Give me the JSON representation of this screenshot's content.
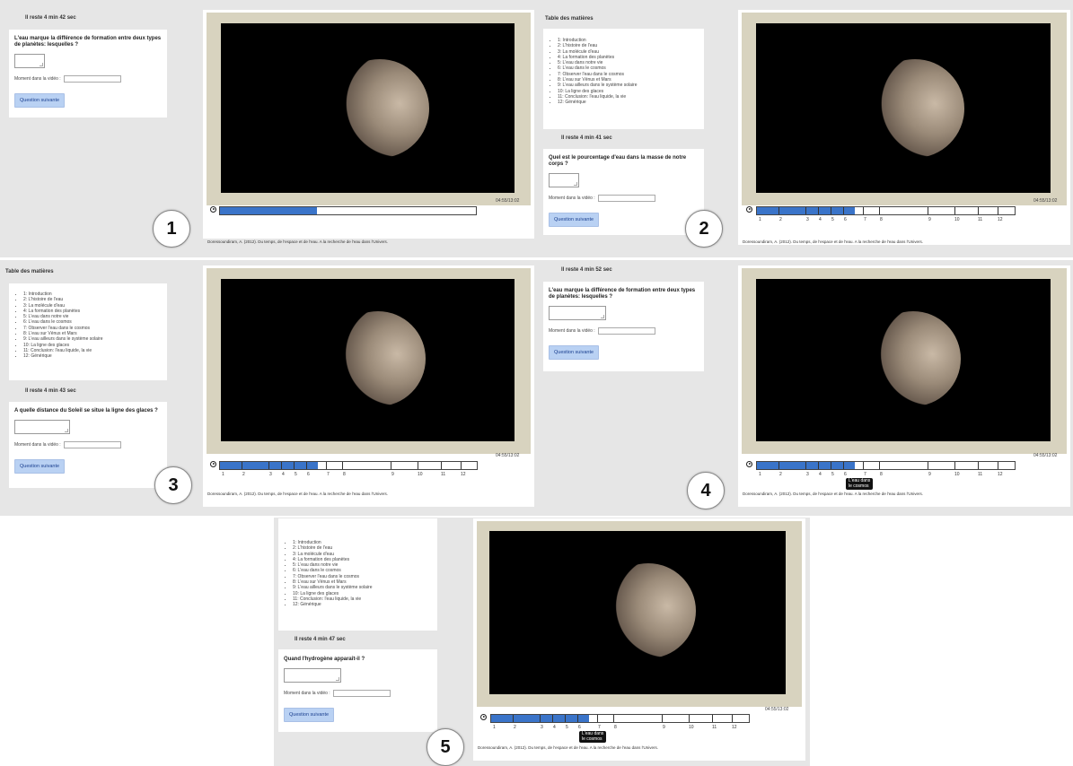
{
  "toc": {
    "title": "Table des matières",
    "items": [
      "1: Introduction",
      "2: L'histoire de l'eau",
      "3: La molécule d'eau",
      "4: La formation des planètes",
      "5: L'eau dans notre vie",
      "6: L'eau dans le cosmos",
      "7: Observer l'eau dans le cosmos",
      "8: L'eau sur Vénus et Mars",
      "9: L'eau ailleurs dans le système solaire",
      "10: La ligne des glaces",
      "11: Conclusion: l'eau liquide, la vie",
      "12: Générique"
    ]
  },
  "common": {
    "moment_label": "Moment dans la vidéo :",
    "next_button": "Question suivante",
    "timecode": "04:55/13:02",
    "citation": "Doressoundiram, A. (2012). Du temps, de l'espace et de l'eau. A la recherche de l'eau dans l'Univers.",
    "chapter_numbers": [
      "1",
      "2",
      "3",
      "4",
      "5",
      "6",
      "7",
      "8",
      "9",
      "10",
      "11",
      "12"
    ],
    "tooltip": "L'eau dans\nle cosmos",
    "accent_color": "#3a74c9",
    "button_color": "#b9d1f3"
  },
  "panels": [
    {
      "badge": "1",
      "timer": "Il reste 4 min 42 sec",
      "question": "L'eau marque la différence de formation entre deux types de planètes: lesquelles ?",
      "progress": 0.38
    },
    {
      "badge": "2",
      "timer": "Il reste 4 min 41 sec",
      "question": "Quel est le pourcentage d'eau dans la masse de notre corps ?",
      "progress": 0.38
    },
    {
      "badge": "3",
      "timer": "Il reste 4 min 43 sec",
      "question": "A quelle distance du Soleil se situe la ligne des glaces ?",
      "progress": 0.38
    },
    {
      "badge": "4",
      "timer": "Il reste 4 min 52 sec",
      "question": "L'eau marque la différence de formation entre deux types de planètes: lesquelles ?",
      "progress": 0.38
    },
    {
      "badge": "5",
      "timer": "Il reste 4 min 47 sec",
      "question": "Quand l'hydrogène apparaît-il ?",
      "progress": 0.38
    }
  ]
}
